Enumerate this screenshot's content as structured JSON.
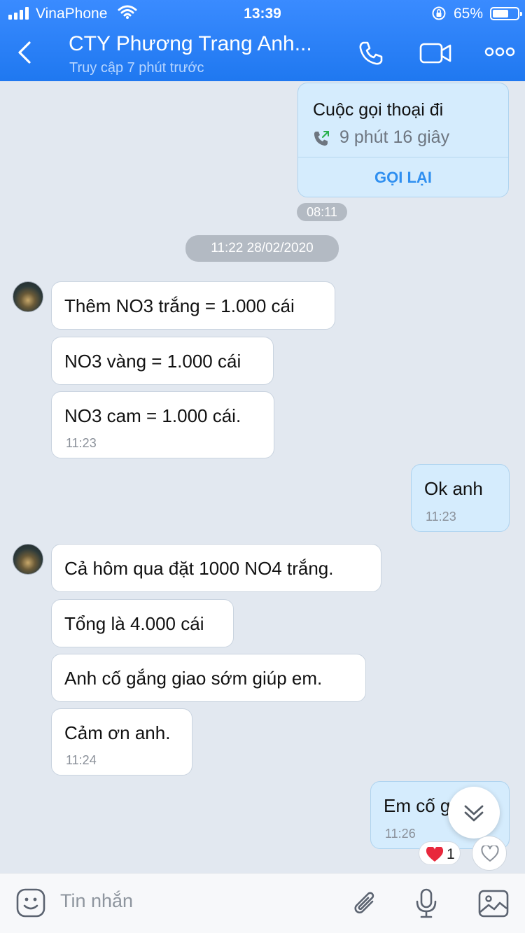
{
  "status_bar": {
    "carrier": "VinaPhone",
    "time": "13:39",
    "battery": "65%",
    "battery_level": 0.65
  },
  "header": {
    "title": "CTY Phương Trang Anh...",
    "subtitle": "Truy cập 7 phút trước"
  },
  "call_card": {
    "title": "Cuộc gọi thoại đi",
    "duration": "9 phút 16 giây",
    "recall_label": "GỌI LẠI",
    "time": "08:11"
  },
  "date_separator": "11:22 28/02/2020",
  "messages": [
    {
      "text": "Thêm NO3 trắng = 1.000 cái",
      "time": ""
    },
    {
      "text": "NO3 vàng = 1.000 cái",
      "time": ""
    },
    {
      "text": "NO3 cam = 1.000 cái.",
      "time": "11:23"
    },
    {
      "text": "Ok anh",
      "time": "11:23"
    },
    {
      "text": "Cả hôm qua đặt 1000 NO4 trắng.",
      "time": ""
    },
    {
      "text": "Tổng là 4.000 cái",
      "time": ""
    },
    {
      "text": "Anh cố gắng giao sớm giúp em.",
      "time": ""
    },
    {
      "text": "Cảm ơn anh.",
      "time": "11:24"
    },
    {
      "text": "Em cố g",
      "time": "11:26"
    }
  ],
  "reaction": {
    "count": "1"
  },
  "input": {
    "placeholder": "Tin nhắn"
  },
  "colors": {
    "header": "#1f78f0",
    "my_bubble": "#d5ecfd",
    "accent": "#2f8ff0",
    "heart": "#e8283c"
  }
}
